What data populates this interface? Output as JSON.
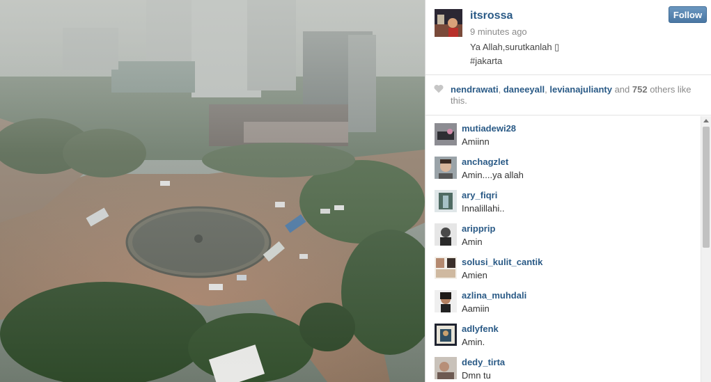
{
  "post": {
    "username": "itsrossa",
    "time_ago": "9 minutes ago",
    "caption_line1": "Ya Allah,surutkanlah ▯",
    "caption_line2": "#jakarta",
    "follow_label": "Follow"
  },
  "likes": {
    "user1": "nendrawati",
    "sep1": ", ",
    "user2": "daneeyall",
    "sep2": ", ",
    "user3": "levianajulianty",
    "and_text": " and ",
    "count": "752",
    "others_text": " others like this."
  },
  "comments": [
    {
      "user": "mutiadewi28",
      "text": "Amiinn"
    },
    {
      "user": "anchagzlet",
      "text": "Amin....ya allah"
    },
    {
      "user": "ary_fiqri",
      "text": "Innalillahi.."
    },
    {
      "user": "aripprip",
      "text": "Amin"
    },
    {
      "user": "solusi_kulit_cantik",
      "text": "Amien"
    },
    {
      "user": "azlina_muhdali",
      "text": "Aamiin"
    },
    {
      "user": "adlyfenk",
      "text": "Amin."
    },
    {
      "user": "dedy_tirta",
      "text": "Dmn tu"
    }
  ],
  "colors": {
    "link": "#2a5a86",
    "follow_button": "#4a77a3",
    "muted_text": "#8a8a8a"
  },
  "icons": {
    "like": "heart-icon",
    "scroll": "scroll-up-arrow-icon"
  }
}
